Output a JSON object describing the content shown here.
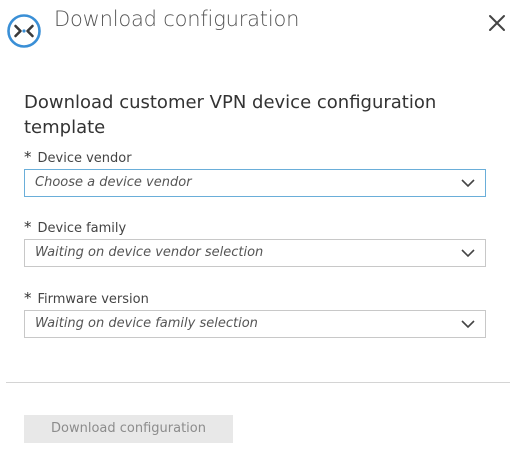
{
  "header": {
    "title": "Download configuration",
    "app_icon": "vpn-connection-icon",
    "close_icon": "close-icon"
  },
  "form": {
    "heading": "Download customer VPN device configuration template",
    "required_marker": "*",
    "fields": [
      {
        "label": "Device vendor",
        "value": "Choose a device vendor",
        "focused": true
      },
      {
        "label": "Device family",
        "value": "Waiting on device vendor selection",
        "focused": false
      },
      {
        "label": "Firmware version",
        "value": "Waiting on device family selection",
        "focused": false
      }
    ]
  },
  "footer": {
    "download_label": "Download configuration",
    "download_enabled": false
  },
  "colors": {
    "focus_border": "#6aaed9",
    "icon_accent": "#3a8fd6",
    "disabled_button_bg": "#e8e8e8",
    "disabled_button_text": "#8c8c8c"
  }
}
